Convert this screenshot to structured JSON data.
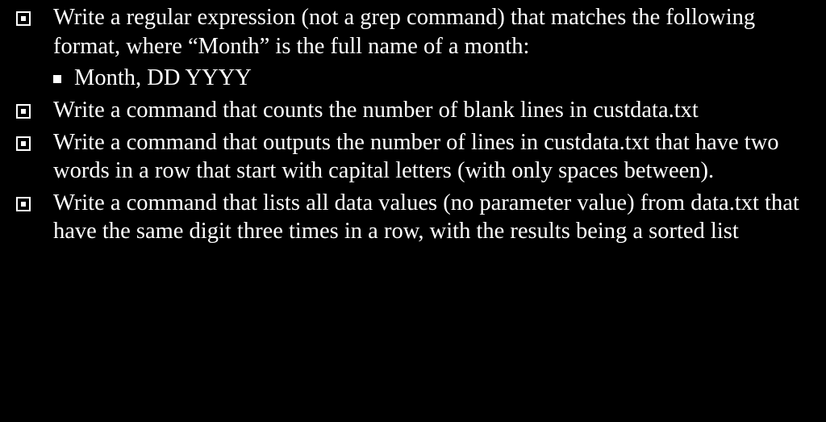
{
  "items": [
    {
      "level": 1,
      "text": "Write a regular expression (not a grep command) that matches the following format, where “Month” is the full name of a month:"
    },
    {
      "level": 2,
      "text": "Month, DD YYYY"
    },
    {
      "level": 1,
      "text": "Write a command that counts the number of blank lines in custdata.txt"
    },
    {
      "level": 1,
      "text": "Write a command that outputs the number of lines in custdata.txt that have two words in a row that start with capital letters (with only spaces between)."
    },
    {
      "level": 1,
      "text": "Write a command that lists all data values (no parameter value) from data.txt that have the same digit three times in a row, with the results being a sorted list"
    }
  ]
}
